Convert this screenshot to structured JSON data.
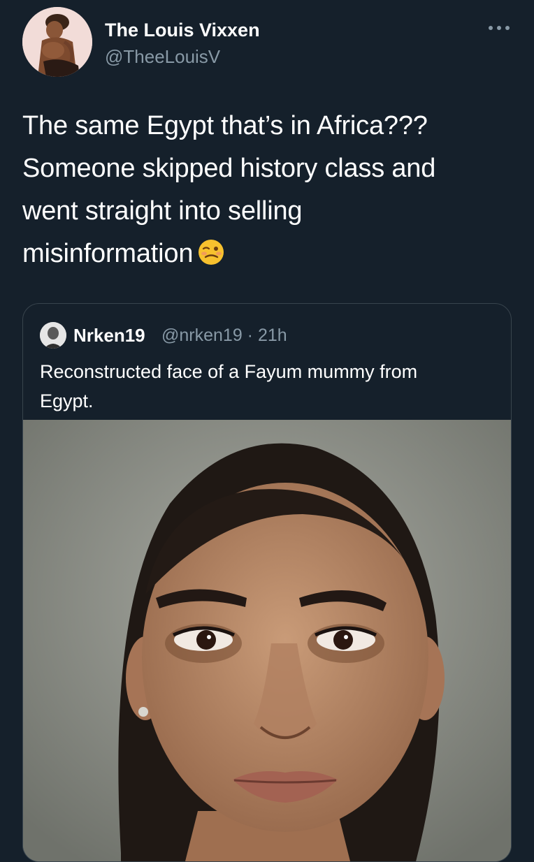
{
  "author": {
    "display_name": "The Louis Vixxen",
    "handle": "@TheeLouisV",
    "avatar_icon": "profile-photo"
  },
  "more_icon": "more-horizontal-icon",
  "tweet": {
    "lines": [
      "The same Egypt that’s in Africa???",
      "Someone skipped history class and",
      "went straight into selling",
      "misinformation"
    ],
    "emoji": "woozy-face-emoji"
  },
  "quoted_tweet": {
    "display_name": "Nrken19",
    "handle_time": "@nrken19 · 21h",
    "text_lines": [
      "Reconstructed face of a Fayum mummy from",
      "Egypt."
    ],
    "media_icon": "portrait-photo"
  },
  "colors": {
    "background": "#15202b",
    "text": "#ffffff",
    "secondary_text": "#8899a6",
    "border": "#38444d"
  }
}
